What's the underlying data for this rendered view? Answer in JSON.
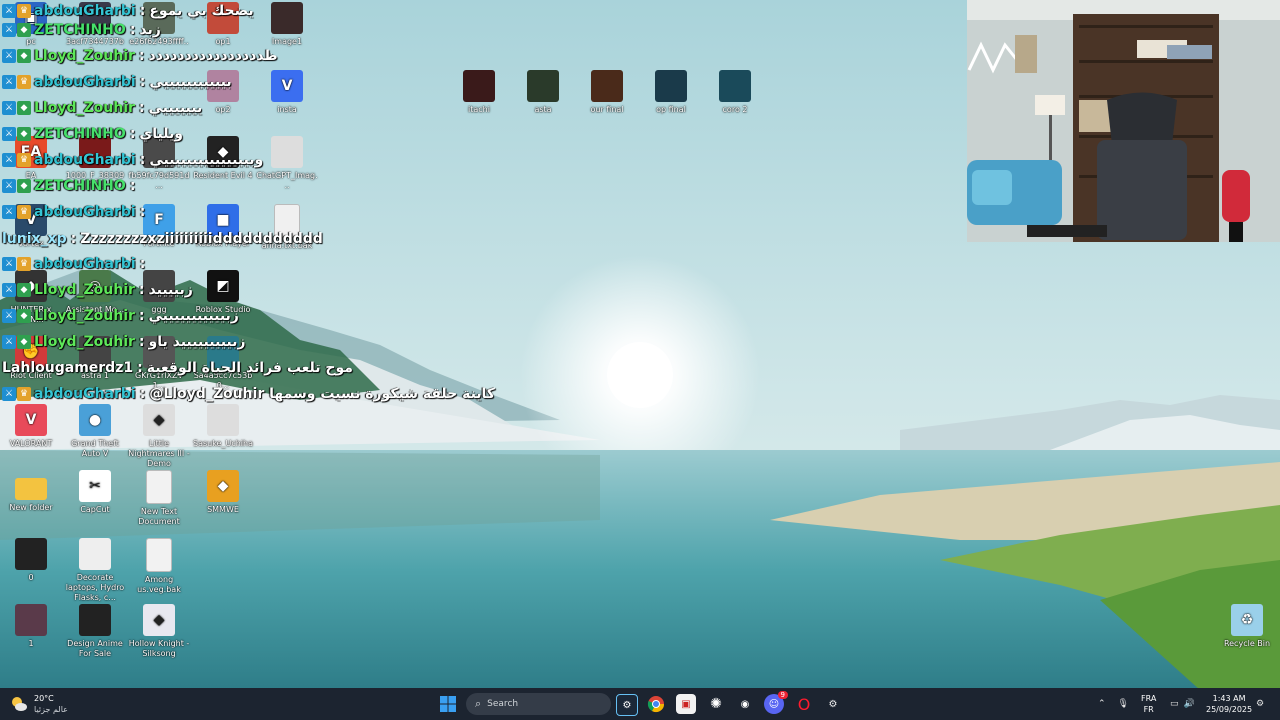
{
  "desktop_icons": [
    {
      "id": "pc",
      "label": "pc",
      "icon": "pc-icon",
      "color": "#2b66c4"
    },
    {
      "id": "file1",
      "label": "3acf7344737b3...",
      "icon": "image-file-icon",
      "color": "#3a3a4a"
    },
    {
      "id": "file2",
      "label": "e26f62493ffff...",
      "icon": "image-file-icon",
      "color": "#5a6a5a"
    },
    {
      "id": "op1",
      "label": "op1",
      "icon": "image-file-icon",
      "color": "#c24b3a"
    },
    {
      "id": "image1",
      "label": "Image1",
      "icon": "image-file-icon",
      "color": "#3a2a2a"
    },
    {
      "id": "op2",
      "label": "op2",
      "icon": "image-file-icon",
      "color": "#b083a0"
    },
    {
      "id": "insta",
      "label": "insta",
      "icon": "v-app-icon",
      "color": "#3b6ef0"
    },
    {
      "id": "ea",
      "label": "EA",
      "icon": "ea-icon",
      "color": "#e84a2a"
    },
    {
      "id": "file3",
      "label": "1000_F_3830976...",
      "icon": "image-file-icon",
      "color": "#7a1a1a"
    },
    {
      "id": "file4",
      "label": "fb59fc79d591d...",
      "icon": "image-file-icon",
      "color": "#4a4a4a"
    },
    {
      "id": "re4",
      "label": "Resident Evil 4",
      "icon": "game-icon",
      "color": "#222"
    },
    {
      "id": "chatgpt",
      "label": "ChatGPT_Imag...",
      "icon": "image-file-icon",
      "color": "#ddd"
    },
    {
      "id": "vortex",
      "label": "Vortex",
      "icon": "vortex-icon",
      "color": "#2a4a6a"
    },
    {
      "id": "fileicon",
      "label": "Fortnite",
      "icon": "f-icon",
      "color": "#3fa0e8"
    },
    {
      "id": "roblox",
      "label": "Roblox Player",
      "icon": "roblox-icon",
      "color": "#2f6ee8"
    },
    {
      "id": "anna",
      "label": "anna.txt.bak",
      "icon": "document-icon",
      "color": "#f0f0f0"
    },
    {
      "id": "hunter",
      "label": "HUNTER x HUN...",
      "icon": "game-icon",
      "color": "#333"
    },
    {
      "id": "assistant",
      "label": "Assistant Mo...",
      "icon": "app-icon",
      "color": "#4a7a4a"
    },
    {
      "id": "ggg",
      "label": "ggg",
      "icon": "image-file-icon",
      "color": "#444"
    },
    {
      "id": "robloxstudio",
      "label": "Roblox Studio",
      "icon": "roblox-studio-icon",
      "color": "#111"
    },
    {
      "id": "riot",
      "label": "Riot Client",
      "icon": "riot-icon",
      "color": "#d23a3a"
    },
    {
      "id": "astra",
      "label": "astra 1",
      "icon": "image-file-icon",
      "color": "#444"
    },
    {
      "id": "file5",
      "label": "GKrG1rlXZV 1...",
      "icon": "image-file-icon",
      "color": "#555"
    },
    {
      "id": "file6",
      "label": "Sa4a5cc7c53b0...",
      "icon": "image-file-icon",
      "color": "#2a7a8a"
    },
    {
      "id": "valorant",
      "label": "VALORANT",
      "icon": "valorant-icon",
      "color": "#e84a5a"
    },
    {
      "id": "gta",
      "label": "Grand Theft Auto V",
      "icon": "globe-icon",
      "color": "#4aa0d8"
    },
    {
      "id": "littlenightmares",
      "label": "Little Nightmares III - Demo",
      "icon": "game-icon",
      "color": "#ddd"
    },
    {
      "id": "sasuke",
      "label": "Sasuke_Uchiha",
      "icon": "image-file-icon",
      "color": "#ddd"
    },
    {
      "id": "newfolder",
      "label": "New folder",
      "icon": "folder-icon",
      "color": "#f3c340"
    },
    {
      "id": "capcut",
      "label": "CapCut",
      "icon": "capcut-icon",
      "color": "#fff"
    },
    {
      "id": "newtext",
      "label": "New Text Document",
      "icon": "document-icon",
      "color": "#f2f2f2"
    },
    {
      "id": "smmwe",
      "label": "SMMWE",
      "icon": "game-icon",
      "color": "#e8a020"
    },
    {
      "id": "zero",
      "label": "0",
      "icon": "image-file-icon",
      "color": "#222"
    },
    {
      "id": "decorate",
      "label": "Decorate laptops, Hydro Flasks, c...",
      "icon": "image-file-icon",
      "color": "#eee"
    },
    {
      "id": "among",
      "label": "Among us.veg.bak",
      "icon": "document-icon",
      "color": "#f2f2f2"
    },
    {
      "id": "one",
      "label": "1",
      "icon": "image-file-icon",
      "color": "#5a3a4a"
    },
    {
      "id": "designanime",
      "label": "Design Anime For Sale",
      "icon": "image-file-icon",
      "color": "#222"
    },
    {
      "id": "hollow",
      "label": "Hollow Knight - Silksong",
      "icon": "game-icon",
      "color": "#e8e8f0"
    },
    {
      "id": "itachi",
      "label": "itachi",
      "icon": "image-file-icon",
      "color": "#3a1a1a"
    },
    {
      "id": "asta",
      "label": "asta",
      "icon": "image-file-icon",
      "color": "#2a3a2a"
    },
    {
      "id": "opfinal",
      "label": "our final",
      "icon": "image-file-icon",
      "color": "#4a2a1a"
    },
    {
      "id": "opfinal2",
      "label": "op final",
      "icon": "image-file-icon",
      "color": "#1a3a4a"
    },
    {
      "id": "coro",
      "label": "coro 2",
      "icon": "image-file-icon",
      "color": "#1a4a5a"
    },
    {
      "id": "recycle",
      "label": "Recycle Bin",
      "icon": "recycle-bin-icon",
      "color": "#9ad0ea"
    }
  ],
  "chat": [
    {
      "user": "abdouGharbi",
      "text": "يضحك بي يموع",
      "cls": "u-abdou",
      "badges": [
        "mod",
        "crown"
      ]
    },
    {
      "user": "ZETCHINHO",
      "text": "زبد",
      "cls": "u-zet",
      "badges": [
        "mod",
        "vip"
      ]
    },
    {
      "user": "Lloyd_Zouhir",
      "text": "ظدددددددددددددددد",
      "cls": "u-lloyd",
      "badges": [
        "mod",
        "vip"
      ]
    },
    {
      "user": "abdouGharbi",
      "text": "بيييييييييييي",
      "cls": "u-abdou",
      "badges": [
        "mod",
        "crown"
      ]
    },
    {
      "user": "Lloyd_Zouhir",
      "text": "يييييييي",
      "cls": "u-lloyd",
      "badges": [
        "mod",
        "vip"
      ]
    },
    {
      "user": "ZETCHINHO",
      "text": "ويلياي",
      "cls": "u-zet",
      "badges": [
        "mod",
        "vip"
      ]
    },
    {
      "user": "abdouGharbi",
      "text": "وبيييييييييييييييي",
      "cls": "u-abdou",
      "badges": [
        "mod",
        "crown"
      ]
    },
    {
      "user": "ZETCHINHO",
      "text": "",
      "cls": "u-zet",
      "badges": [
        "mod",
        "vip"
      ]
    },
    {
      "user": "abdouGharbi",
      "text": "",
      "cls": "u-abdou",
      "badges": [
        "mod",
        "crown"
      ]
    },
    {
      "user": "lunix_xp",
      "text": "Zzzzzzzzxziiiiiiiiiiddddddddddd",
      "cls": "u-lunix",
      "badges": []
    },
    {
      "user": "abdouGharbi",
      "text": "",
      "cls": "u-abdou",
      "badges": [
        "mod",
        "crown"
      ]
    },
    {
      "user": "Lloyd_Zouhir",
      "text": "زبييييد",
      "cls": "u-lloyd",
      "badges": [
        "mod",
        "vip"
      ]
    },
    {
      "user": "Lloyd_Zouhir",
      "text": "زبيييييييييييي",
      "cls": "u-lloyd",
      "badges": [
        "mod",
        "vip"
      ]
    },
    {
      "user": "Lloyd_Zouhir",
      "text": "زبيييييييييد ياو",
      "cls": "u-lloyd",
      "badges": [
        "mod",
        "vip"
      ]
    },
    {
      "user": "Lahlougamerdz1",
      "text": "موح تلعب فرائد الحياة الوقعية",
      "cls": "u-lahl",
      "badges": []
    },
    {
      "user": "abdouGharbi",
      "text": "@Lloyd_Zouhir كاينة حلقة شيكورة نسيت وسمها",
      "cls": "u-abdou",
      "badges": [
        "mod",
        "crown"
      ]
    }
  ],
  "taskbar": {
    "weather_temp": "20°C",
    "weather_desc": "عالم جزئيا",
    "search_placeholder": "Search",
    "lang_top": "FRA",
    "lang_bottom": "FR",
    "time": "1:43 AM",
    "date": "25/09/2025",
    "discord_badge": "9",
    "apps": [
      "steam-icon",
      "chrome-icon",
      "app-icon",
      "chatgpt-icon",
      "location-icon",
      "discord-icon",
      "opera-icon",
      "game-icon"
    ]
  }
}
